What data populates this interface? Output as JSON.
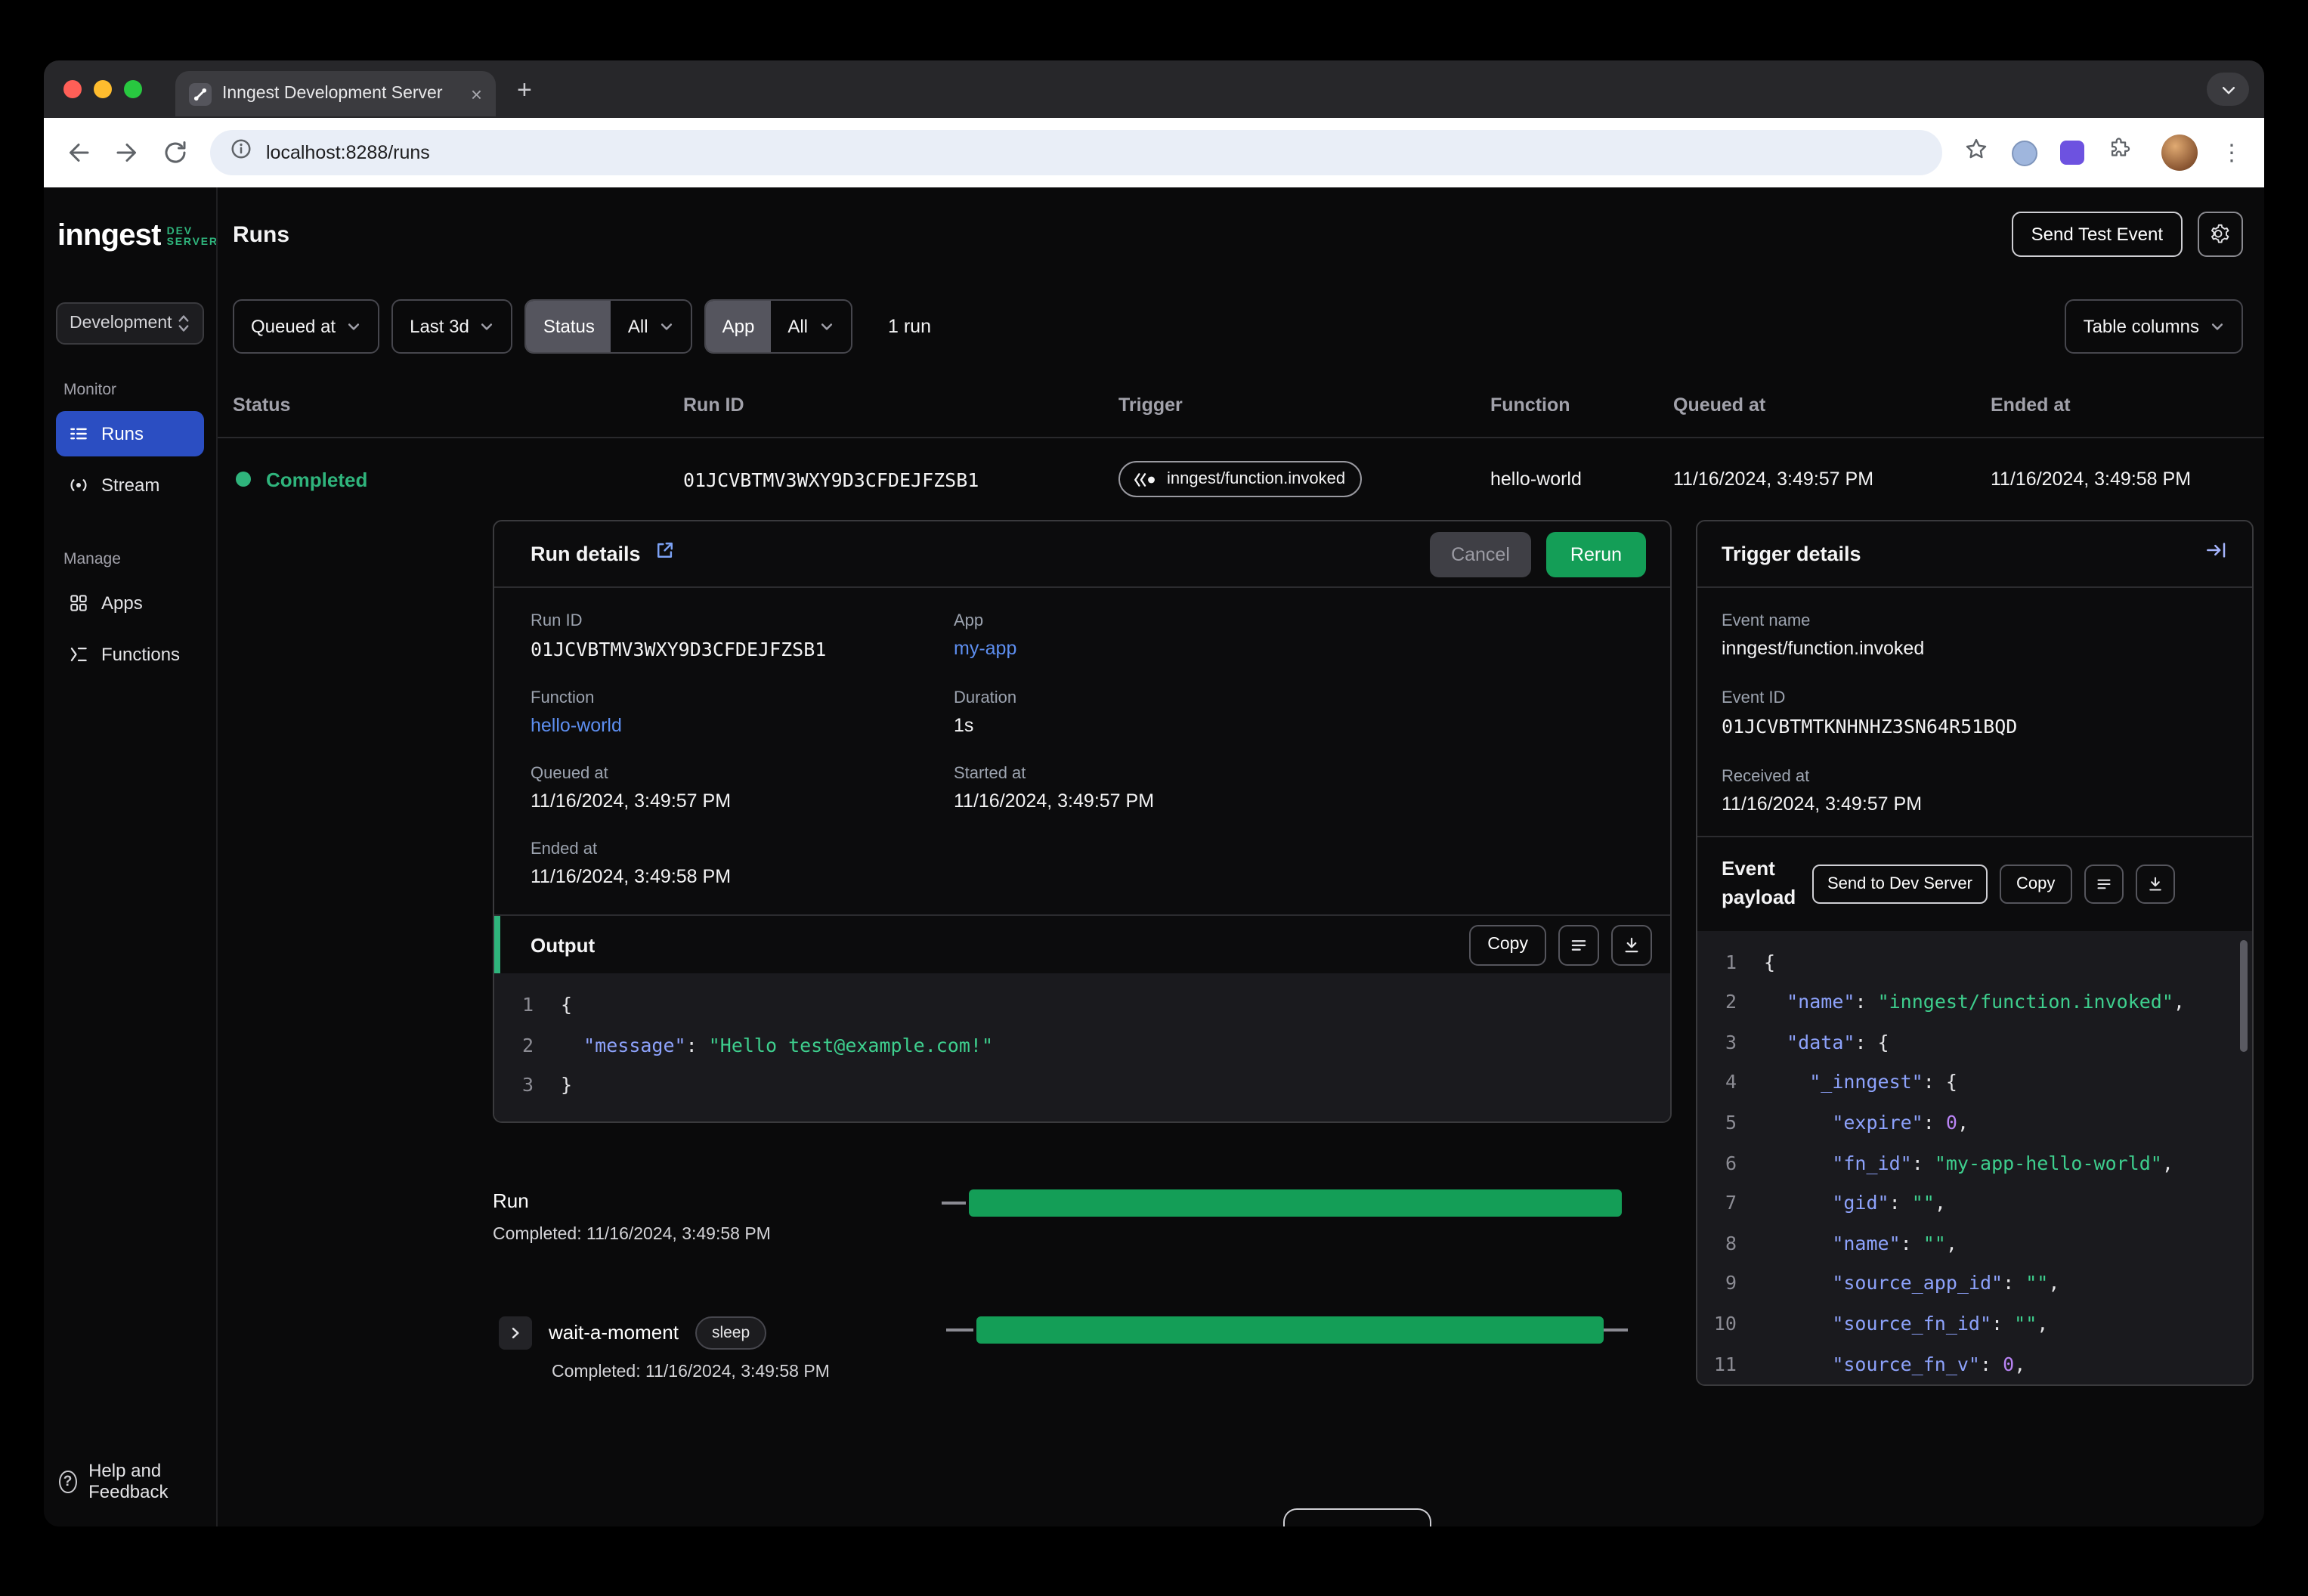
{
  "colors": {
    "accent_green": "#2fb47c",
    "bar_green": "#149e57",
    "active_blue": "#2b4ec2",
    "link_blue": "#5d8eef",
    "json_key": "#8da2fb",
    "json_string": "#3ecf8e",
    "json_number": "#b984f5"
  },
  "browser": {
    "tab_title": "Inngest Development Server",
    "url": "localhost:8288/runs"
  },
  "sidebar": {
    "logo": "inngest",
    "logo_badge": "DEV SERVER",
    "env_select": "Development",
    "sections": [
      {
        "label": "Monitor",
        "items": [
          {
            "label": "Runs"
          },
          {
            "label": "Stream"
          }
        ]
      },
      {
        "label": "Manage",
        "items": [
          {
            "label": "Apps"
          },
          {
            "label": "Functions"
          }
        ]
      }
    ],
    "help": "Help and Feedback"
  },
  "header": {
    "title": "Runs",
    "send_test_event": "Send Test Event"
  },
  "filters": {
    "queued_at": "Queued at",
    "time_range": "Last 3d",
    "status_label": "Status",
    "status_value": "All",
    "app_label": "App",
    "app_value": "All",
    "run_count": "1 run",
    "table_columns": "Table columns"
  },
  "table": {
    "columns": [
      "Status",
      "Run ID",
      "Trigger",
      "Function",
      "Queued at",
      "Ended at"
    ],
    "row": {
      "status": "Completed",
      "run_id": "01JCVBTMV3WXY9D3CFDEJFZSB1",
      "trigger": "inngest/function.invoked",
      "function": "hello-world",
      "queued_at": "11/16/2024, 3:49:57 PM",
      "ended_at": "11/16/2024, 3:49:58 PM"
    }
  },
  "run_details": {
    "title": "Run details",
    "cancel": "Cancel",
    "rerun": "Rerun",
    "fields": [
      {
        "label": "Run ID",
        "value": "01JCVBTMV3WXY9D3CFDEJFZSB1"
      },
      {
        "label": "App",
        "value": "my-app"
      },
      {
        "label": "Function",
        "value": "hello-world"
      },
      {
        "label": "Duration",
        "value": "1s"
      },
      {
        "label": "Queued at",
        "value": "11/16/2024, 3:49:57 PM"
      },
      {
        "label": "Started at",
        "value": "11/16/2024, 3:49:57 PM"
      },
      {
        "label": "Ended at",
        "value": "11/16/2024, 3:49:58 PM"
      }
    ],
    "output": {
      "title": "Output",
      "copy": "Copy",
      "lines": [
        [
          {
            "t": "{",
            "c": "p"
          }
        ],
        [
          {
            "t": "  ",
            "c": "p"
          },
          {
            "t": "\"message\"",
            "c": "k"
          },
          {
            "t": ": ",
            "c": "p"
          },
          {
            "t": "\"Hello test@example.com!\"",
            "c": "s"
          }
        ],
        [
          {
            "t": "}",
            "c": "p"
          }
        ]
      ]
    }
  },
  "timeline": {
    "run": {
      "label": "Run",
      "status": "Completed: 11/16/2024, 3:49:58 PM"
    },
    "step": {
      "label": "wait-a-moment",
      "badge": "sleep",
      "status": "Completed: 11/16/2024, 3:49:58 PM"
    }
  },
  "trigger_details": {
    "title": "Trigger details",
    "fields": [
      {
        "label": "Event name",
        "value": "inngest/function.invoked"
      },
      {
        "label": "Event ID",
        "value": "01JCVBTMTKNHNHZ3SN64R51BQD"
      },
      {
        "label": "Received at",
        "value": "11/16/2024, 3:49:57 PM"
      }
    ],
    "payload": {
      "title": "Event payload",
      "send_to_dev_server": "Send to Dev Server",
      "copy": "Copy",
      "lines": [
        [
          {
            "t": "{",
            "c": "p"
          }
        ],
        [
          {
            "t": "  ",
            "c": "p"
          },
          {
            "t": "\"name\"",
            "c": "k"
          },
          {
            "t": ": ",
            "c": "p"
          },
          {
            "t": "\"inngest/function.invoked\"",
            "c": "s"
          },
          {
            "t": ",",
            "c": "p"
          }
        ],
        [
          {
            "t": "  ",
            "c": "p"
          },
          {
            "t": "\"data\"",
            "c": "k"
          },
          {
            "t": ": {",
            "c": "p"
          }
        ],
        [
          {
            "t": "    ",
            "c": "p"
          },
          {
            "t": "\"_inngest\"",
            "c": "k"
          },
          {
            "t": ": {",
            "c": "p"
          }
        ],
        [
          {
            "t": "      ",
            "c": "p"
          },
          {
            "t": "\"expire\"",
            "c": "k"
          },
          {
            "t": ": ",
            "c": "p"
          },
          {
            "t": "0",
            "c": "n"
          },
          {
            "t": ",",
            "c": "p"
          }
        ],
        [
          {
            "t": "      ",
            "c": "p"
          },
          {
            "t": "\"fn_id\"",
            "c": "k"
          },
          {
            "t": ": ",
            "c": "p"
          },
          {
            "t": "\"my-app-hello-world\"",
            "c": "s"
          },
          {
            "t": ",",
            "c": "p"
          }
        ],
        [
          {
            "t": "      ",
            "c": "p"
          },
          {
            "t": "\"gid\"",
            "c": "k"
          },
          {
            "t": ": ",
            "c": "p"
          },
          {
            "t": "\"\"",
            "c": "s"
          },
          {
            "t": ",",
            "c": "p"
          }
        ],
        [
          {
            "t": "      ",
            "c": "p"
          },
          {
            "t": "\"name\"",
            "c": "k"
          },
          {
            "t": ": ",
            "c": "p"
          },
          {
            "t": "\"\"",
            "c": "s"
          },
          {
            "t": ",",
            "c": "p"
          }
        ],
        [
          {
            "t": "      ",
            "c": "p"
          },
          {
            "t": "\"source_app_id\"",
            "c": "k"
          },
          {
            "t": ": ",
            "c": "p"
          },
          {
            "t": "\"\"",
            "c": "s"
          },
          {
            "t": ",",
            "c": "p"
          }
        ],
        [
          {
            "t": "      ",
            "c": "p"
          },
          {
            "t": "\"source_fn_id\"",
            "c": "k"
          },
          {
            "t": ": ",
            "c": "p"
          },
          {
            "t": "\"\"",
            "c": "s"
          },
          {
            "t": ",",
            "c": "p"
          }
        ],
        [
          {
            "t": "      ",
            "c": "p"
          },
          {
            "t": "\"source_fn_v\"",
            "c": "k"
          },
          {
            "t": ": ",
            "c": "p"
          },
          {
            "t": "0",
            "c": "n"
          },
          {
            "t": ",",
            "c": "p"
          }
        ]
      ]
    }
  }
}
